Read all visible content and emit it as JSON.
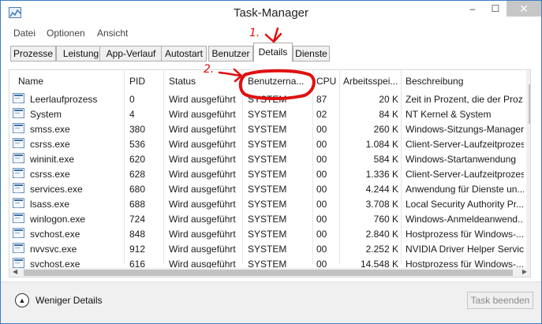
{
  "window": {
    "title": "Task-Manager"
  },
  "controls": {
    "minimize": "–",
    "maximize": "☐",
    "close": "✕"
  },
  "menu": [
    "Datei",
    "Optionen",
    "Ansicht"
  ],
  "tabs": [
    {
      "label": "Prozesse",
      "active": false
    },
    {
      "label": "Leistung",
      "active": false
    },
    {
      "label": "App-Verlauf",
      "active": false
    },
    {
      "label": "Autostart",
      "active": false
    },
    {
      "label": "Benutzer",
      "active": false
    },
    {
      "label": "Details",
      "active": true
    },
    {
      "label": "Dienste",
      "active": false
    }
  ],
  "table": {
    "columns": [
      "Name",
      "PID",
      "Status",
      "Benutzerna...",
      "CPU",
      "Arbeitsspei...",
      "Beschreibung"
    ],
    "rows": [
      [
        "Leerlaufprozess",
        "0",
        "Wird ausgeführt",
        "SYSTEM",
        "87",
        "20 K",
        "Zeit in Prozent, die der Proz..."
      ],
      [
        "System",
        "4",
        "Wird ausgeführt",
        "SYSTEM",
        "02",
        "84 K",
        "NT Kernel & System"
      ],
      [
        "smss.exe",
        "380",
        "Wird ausgeführt",
        "SYSTEM",
        "00",
        "260 K",
        "Windows-Sitzungs-Manager"
      ],
      [
        "csrss.exe",
        "536",
        "Wird ausgeführt",
        "SYSTEM",
        "00",
        "1.084 K",
        "Client-Server-Laufzeitprozess"
      ],
      [
        "wininit.exe",
        "620",
        "Wird ausgeführt",
        "SYSTEM",
        "00",
        "584 K",
        "Windows-Startanwendung"
      ],
      [
        "csrss.exe",
        "628",
        "Wird ausgeführt",
        "SYSTEM",
        "00",
        "1.336 K",
        "Client-Server-Laufzeitprozess"
      ],
      [
        "services.exe",
        "680",
        "Wird ausgeführt",
        "SYSTEM",
        "00",
        "4.244 K",
        "Anwendung für Dienste un..."
      ],
      [
        "lsass.exe",
        "688",
        "Wird ausgeführt",
        "SYSTEM",
        "00",
        "3.708 K",
        "Local Security Authority Pr..."
      ],
      [
        "winlogon.exe",
        "724",
        "Wird ausgeführt",
        "SYSTEM",
        "00",
        "760 K",
        "Windows-Anmeldeanwend..."
      ],
      [
        "svchost.exe",
        "848",
        "Wird ausgeführt",
        "SYSTEM",
        "00",
        "2.840 K",
        "Hostprozess für Windows-..."
      ],
      [
        "nvvsvc.exe",
        "912",
        "Wird ausgeführt",
        "SYSTEM",
        "00",
        "2.252 K",
        "NVIDIA Driver Helper Servic..."
      ],
      [
        "svchost.exe",
        "616",
        "Wird ausgeführt",
        "SYSTEM",
        "00",
        "14.548 K",
        "Hostprozess für Windows-..."
      ]
    ]
  },
  "footer": {
    "less_details": "Weniger Details",
    "end_task": "Task beenden"
  },
  "annotations": {
    "step1": "1.",
    "step2": "2.",
    "color": "#e01010"
  }
}
